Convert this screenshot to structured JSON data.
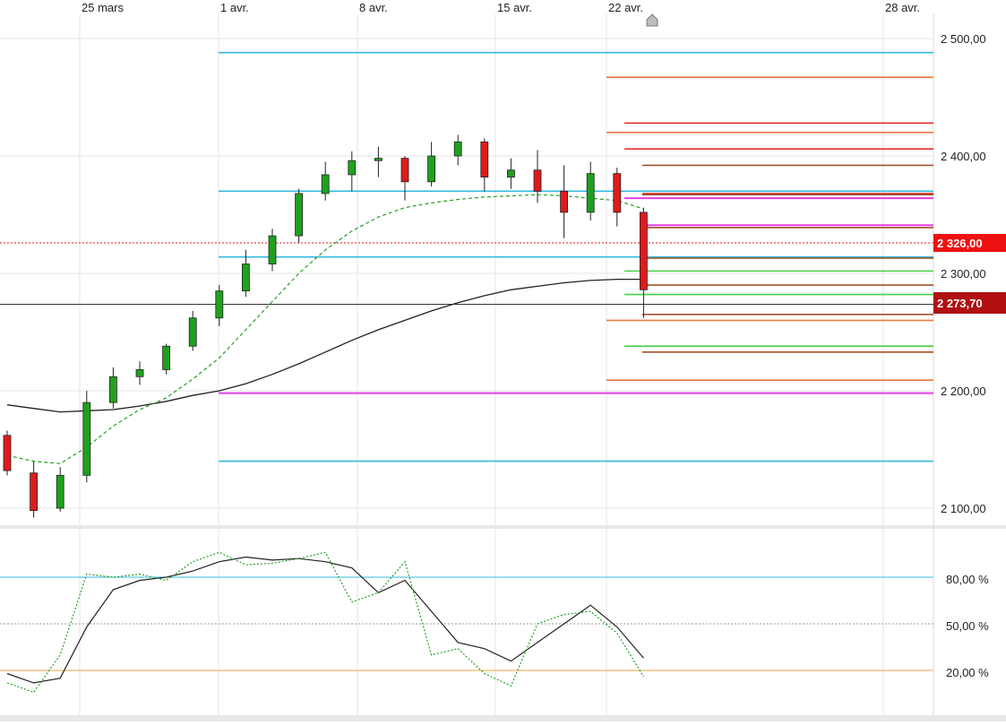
{
  "date_labels": [
    "25 mars",
    "1 avr.",
    "8 avr.",
    "15 avr.",
    "22 avr.",
    "28 avr."
  ],
  "price_axis_labels": [
    "2 500,00",
    "2 400,00",
    "2 300,00",
    "2 200,00",
    "2 100,00"
  ],
  "stoch_axis_labels": [
    "80,00 %",
    "50,00 %",
    "20,00 %"
  ],
  "price_tags": {
    "red_tag": "2 326,00",
    "dark_tag": "2 273,70"
  },
  "colors": {
    "up_candle": "#1fa11f",
    "down_candle": "#e01b1b",
    "cyan_level": "#33b9de",
    "magenta_level": "#e43ee4",
    "orange_level": "#f0783c",
    "red_level": "#e03232",
    "brown_level": "#a0522d",
    "green_level": "#44d044",
    "ma_long": "#222222",
    "ma_short": "#22a022",
    "tag_red": "#ee1111",
    "tag_dark": "#b01010"
  },
  "chart_data": [
    {
      "type": "candlestick",
      "x": [
        "2024-03-20",
        "2024-03-21",
        "2024-03-22",
        "2024-03-25",
        "2024-03-26",
        "2024-03-27",
        "2024-03-28",
        "2024-03-29",
        "2024-04-01",
        "2024-04-02",
        "2024-04-03",
        "2024-04-04",
        "2024-04-05",
        "2024-04-08",
        "2024-04-09",
        "2024-04-10",
        "2024-04-11",
        "2024-04-12",
        "2024-04-15",
        "2024-04-16",
        "2024-04-17",
        "2024-04-18",
        "2024-04-19",
        "2024-04-22",
        "2024-04-23"
      ],
      "ohlc": [
        [
          2162,
          2166,
          2128,
          2132
        ],
        [
          2130,
          2140,
          2092,
          2098
        ],
        [
          2100,
          2135,
          2097,
          2128
        ],
        [
          2128,
          2200,
          2122,
          2190
        ],
        [
          2190,
          2220,
          2185,
          2212
        ],
        [
          2212,
          2225,
          2205,
          2218
        ],
        [
          2218,
          2240,
          2214,
          2238
        ],
        [
          2238,
          2268,
          2234,
          2262
        ],
        [
          2262,
          2290,
          2255,
          2285
        ],
        [
          2285,
          2320,
          2280,
          2308
        ],
        [
          2308,
          2338,
          2302,
          2332
        ],
        [
          2332,
          2372,
          2326,
          2368
        ],
        [
          2368,
          2395,
          2362,
          2384
        ],
        [
          2384,
          2404,
          2370,
          2396
        ],
        [
          2396,
          2408,
          2382,
          2398
        ],
        [
          2398,
          2400,
          2362,
          2378
        ],
        [
          2378,
          2412,
          2374,
          2400
        ],
        [
          2400,
          2418,
          2392,
          2412
        ],
        [
          2412,
          2415,
          2370,
          2382
        ],
        [
          2382,
          2398,
          2372,
          2388
        ],
        [
          2388,
          2405,
          2360,
          2370
        ],
        [
          2370,
          2392,
          2330,
          2352
        ],
        [
          2352,
          2395,
          2345,
          2385
        ],
        [
          2385,
          2390,
          2340,
          2352
        ],
        [
          2352,
          2356,
          2262,
          2286
        ]
      ],
      "moving_averages": [
        {
          "style": "solid-black",
          "values": [
            2188,
            2185,
            2182,
            2183,
            2184,
            2187,
            2191,
            2196,
            2200,
            2206,
            2214,
            2223,
            2233,
            2243,
            2252,
            2260,
            2268,
            2275,
            2281,
            2286,
            2289,
            2292,
            2294,
            2295,
            2295
          ]
        },
        {
          "style": "dashed-green",
          "values": [
            2145,
            2140,
            2138,
            2152,
            2170,
            2184,
            2194,
            2210,
            2228,
            2252,
            2276,
            2300,
            2320,
            2336,
            2348,
            2356,
            2360,
            2363,
            2365,
            2366,
            2367,
            2366,
            2364,
            2362,
            2355
          ]
        }
      ],
      "level_lines": [
        2488,
        2467,
        2428,
        2420,
        2406,
        2392,
        2370,
        2368,
        2367,
        2364,
        2341,
        2339,
        2326,
        2314,
        2313,
        2302,
        2290,
        2282,
        2265,
        2260,
        2238,
        2233,
        2209,
        2198,
        2140
      ],
      "ylim": [
        2085,
        2525
      ]
    },
    {
      "type": "line",
      "title": "",
      "series": [
        {
          "style": "solid-black",
          "values": [
            18,
            12,
            15,
            48,
            72,
            78,
            80,
            84,
            90,
            93,
            91,
            92,
            90,
            86,
            70,
            78,
            58,
            38,
            34,
            26,
            38,
            50,
            62,
            48,
            28
          ]
        },
        {
          "style": "dotted-green",
          "values": [
            12,
            6,
            30,
            82,
            80,
            82,
            78,
            90,
            96,
            88,
            89,
            92,
            96,
            64,
            70,
            90,
            30,
            34,
            18,
            10,
            50,
            56,
            58,
            44,
            16
          ]
        }
      ],
      "reference_lines": [
        80,
        50,
        20
      ],
      "ylim": [
        0,
        100
      ]
    }
  ]
}
